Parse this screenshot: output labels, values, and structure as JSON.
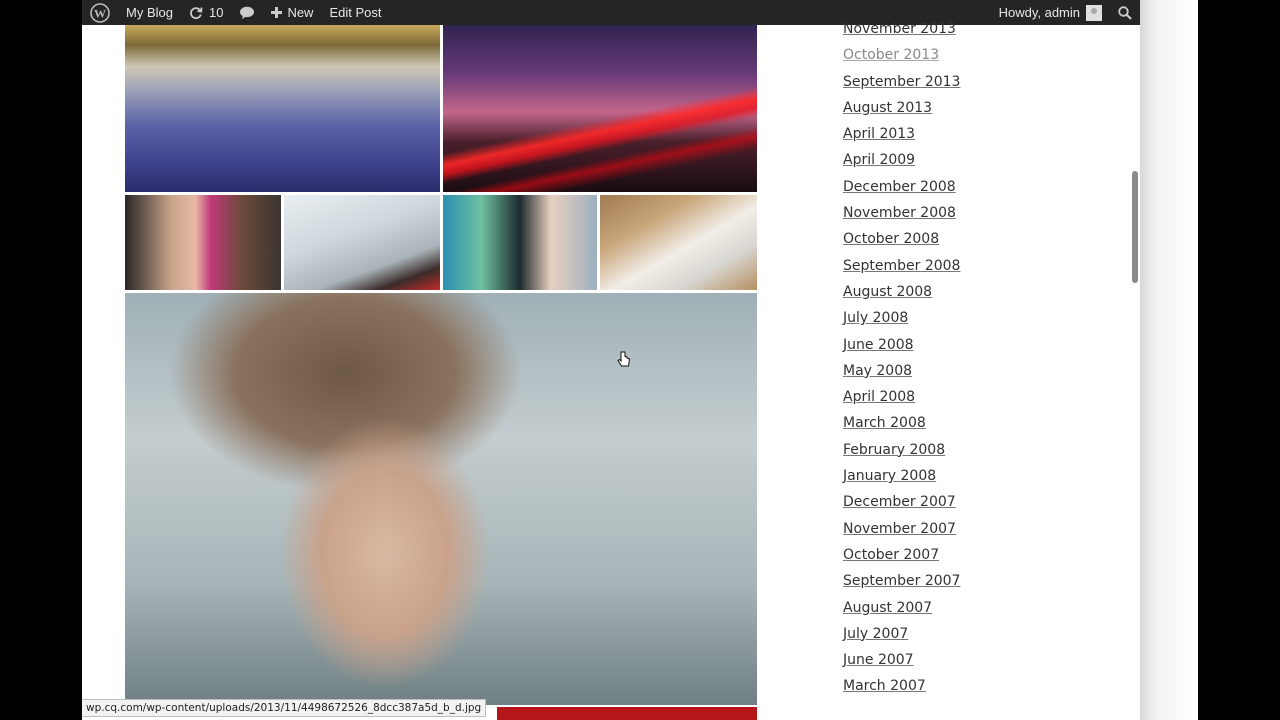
{
  "admin_bar": {
    "site_name": "My Blog",
    "updates_count": "10",
    "new_label": "New",
    "edit_post_label": "Edit Post",
    "greeting": "Howdy, admin"
  },
  "sidebar": {
    "archives": [
      "November 2013",
      "October 2013",
      "September 2013",
      "August 2013",
      "April 2013",
      "April 2009",
      "December 2008",
      "November 2008",
      "October 2008",
      "September 2008",
      "August 2008",
      "July 2008",
      "June 2008",
      "May 2008",
      "April 2008",
      "March 2008",
      "February 2008",
      "January 2008",
      "December 2007",
      "November 2007",
      "October 2007",
      "September 2007",
      "August 2007",
      "July 2007",
      "June 2007",
      "March 2007"
    ]
  },
  "status_url": "wp.cq.com/wp-content/uploads/2013/11/4498672526_8dcc387a5d_b_d.jpg",
  "colors": {
    "admin_bar_bg": "#252525",
    "link_text": "#333333",
    "visited_link": "#888888"
  }
}
